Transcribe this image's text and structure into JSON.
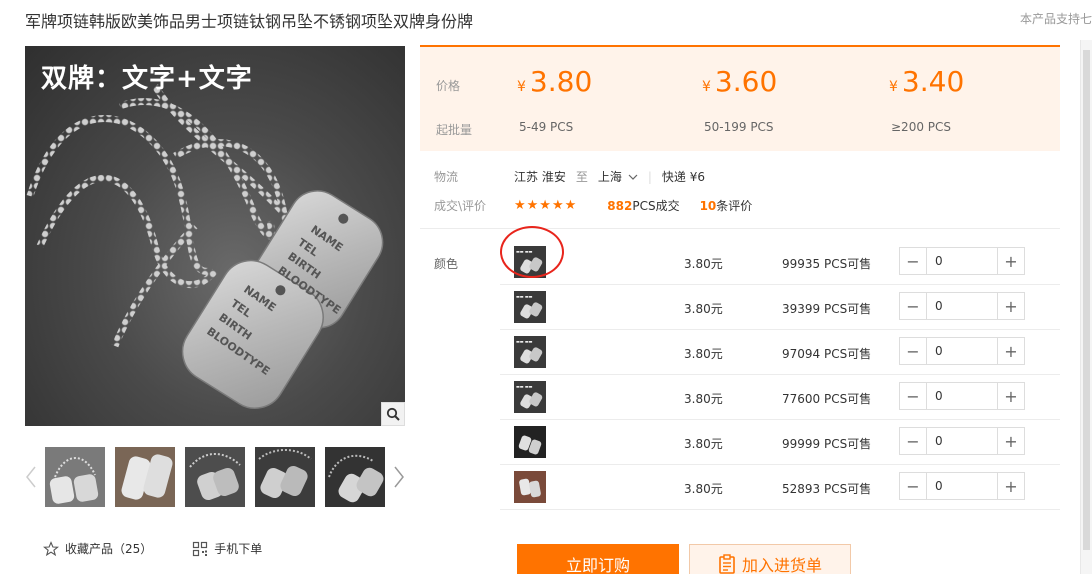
{
  "product": {
    "title": "军牌项链韩版欧美饰品男士项链钛钢吊坠不锈钢项坠双牌身份牌",
    "support_note": "本产品支持七",
    "main_image_caption": "双牌：文字+文字",
    "tag_text": [
      "NAME",
      "TEL",
      "BIRTH",
      "BLOODTYPE"
    ]
  },
  "gallery": {
    "collect_label": "收藏产品（25）",
    "mobile_order_label": "手机下单"
  },
  "pricing": {
    "price_label": "价格",
    "moq_label": "起批量",
    "currency": "¥",
    "tiers": [
      {
        "price": "3.80",
        "range": "5-49  PCS"
      },
      {
        "price": "3.60",
        "range": "50-199  PCS"
      },
      {
        "price": "3.40",
        "range": "≥200  PCS"
      }
    ]
  },
  "logistics": {
    "label": "物流",
    "origin": "江苏 淮安",
    "to": "至",
    "destination": "上海",
    "shipping": "快递 ¥6"
  },
  "rating": {
    "label": "成交\\评价",
    "stars": "★★★★★",
    "deals_count": "882",
    "deals_suffix": "PCS成交",
    "reviews_count": "10",
    "reviews_suffix": "条评价"
  },
  "sku": {
    "label": "颜色",
    "rows": [
      {
        "price": "3.80元",
        "stock": "99935 PCS可售",
        "qty": "0"
      },
      {
        "price": "3.80元",
        "stock": "39399 PCS可售",
        "qty": "0"
      },
      {
        "price": "3.80元",
        "stock": "97094 PCS可售",
        "qty": "0"
      },
      {
        "price": "3.80元",
        "stock": "77600 PCS可售",
        "qty": "0"
      },
      {
        "price": "3.80元",
        "stock": "99999 PCS可售",
        "qty": "0"
      },
      {
        "price": "3.80元",
        "stock": "52893 PCS可售",
        "qty": "0"
      }
    ]
  },
  "actions": {
    "buy_label": "立即订购",
    "cart_label": "加入进货单"
  },
  "colors": {
    "accent": "#ff7300",
    "panel_bg": "#fff3ea",
    "highlight_circle": "#e8251c"
  }
}
